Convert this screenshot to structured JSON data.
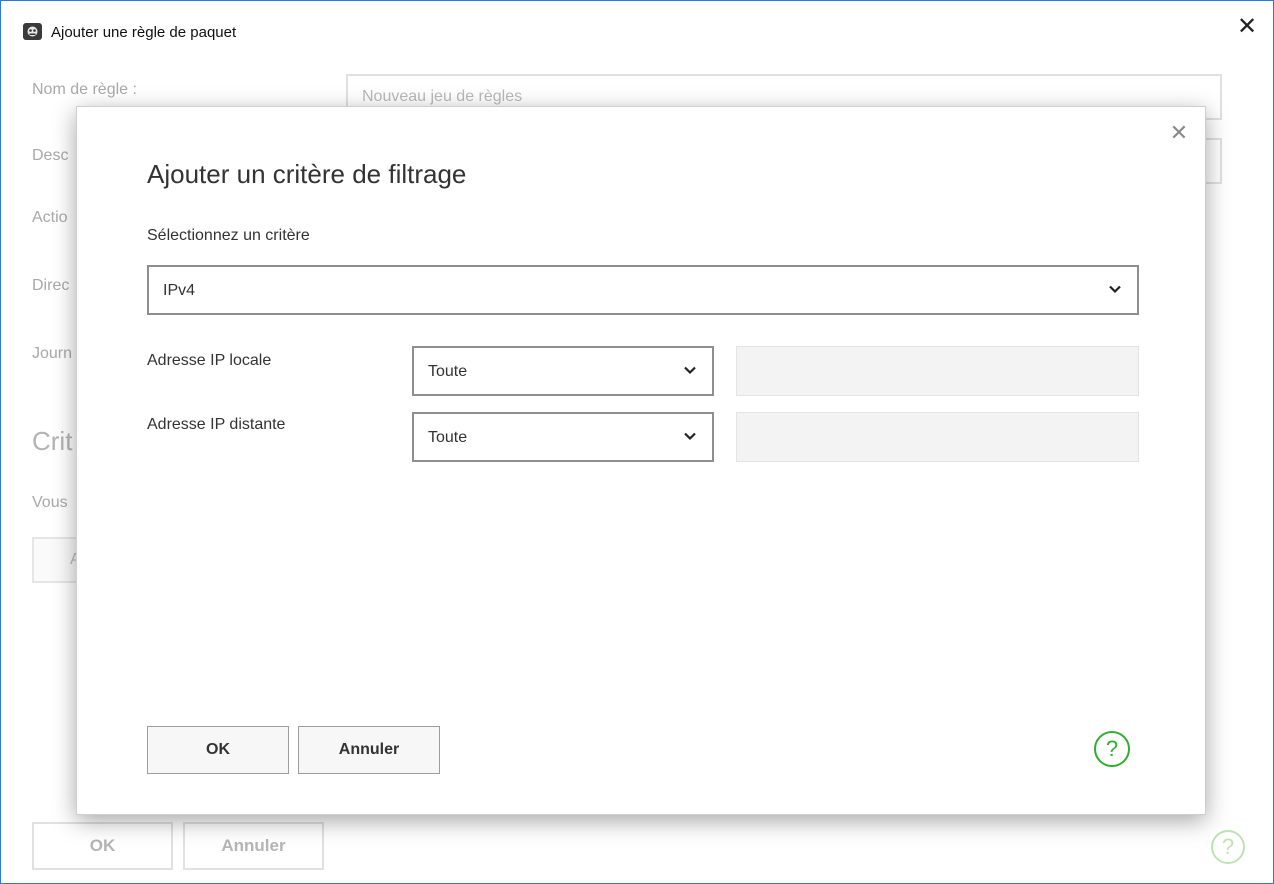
{
  "window": {
    "title": "Ajouter une règle de paquet",
    "close_glyph": "✕",
    "icon": "app-logo-icon"
  },
  "background_form": {
    "rule_name_label": "Nom de règle :",
    "rule_name_placeholder": "Nouveau jeu de règles",
    "description_label": "Desc",
    "action_label": "Actio",
    "direction_label": "Direc",
    "journal_label": "Journ",
    "criteria_heading": "Crit",
    "criteria_hint": "Vous",
    "add_button_label": "A",
    "ok_label": "OK",
    "cancel_label": "Annuler",
    "help_glyph": "?"
  },
  "modal": {
    "title": "Ajouter un critère de filtrage",
    "close_glyph": "✕",
    "criterion_label": "Sélectionnez un critère",
    "criterion_value": "IPv4",
    "local_ip_label": "Adresse IP locale",
    "local_ip_mode": "Toute",
    "remote_ip_label": "Adresse IP distante",
    "remote_ip_mode": "Toute",
    "ok_label": "OK",
    "cancel_label": "Annuler",
    "help_glyph": "?",
    "help_color": "#2fae2f"
  }
}
